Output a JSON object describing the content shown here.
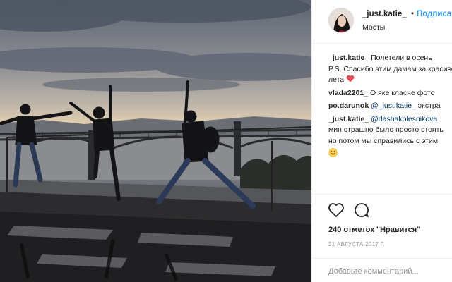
{
  "post": {
    "author": "_just.katie_",
    "separator": "•",
    "follow_label": "Подписаться",
    "location": "Мосты"
  },
  "comments": [
    {
      "user": "_just.katie_",
      "lines": [
        "Полетели в осень",
        "P.S. Спасибо этим дамам за красивое",
        "лета"
      ],
      "emoji_after_last_line": "red-heart"
    },
    {
      "user": "vlada2201_",
      "text": "О яке класне фото"
    },
    {
      "user": "po.darunok",
      "mention": "@_just.katie_",
      "text": "экстра"
    },
    {
      "user": "_just.katie_",
      "mention": "@dashakolesnikova",
      "lines": [
        "мин страшно было просто стоять",
        "но потом мы справились с этим"
      ],
      "emoji_line": "smiling-face"
    }
  ],
  "actions": {
    "like_icon": "heart-outline-icon",
    "comment_icon": "speech-bubble-icon"
  },
  "likes_text": "240 отметок \"Нравится\"",
  "date_text": "31 АВГУСТА 2017 Г.",
  "comment_input": {
    "placeholder": "Добавьте комментарий...",
    "value": ""
  },
  "colors": {
    "follow_blue": "#3897f0",
    "mention": "#003569",
    "heart_red": "#ed4956",
    "muted": "#999999",
    "divider": "#efefef"
  }
}
